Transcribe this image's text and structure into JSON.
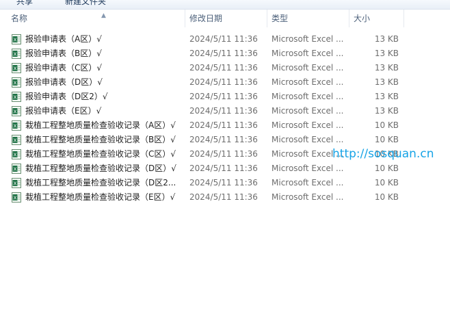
{
  "toolbar": {
    "share_label": "共享",
    "new_folder_label": "新建文件夹"
  },
  "columns": {
    "name": "名称",
    "date": "修改日期",
    "type": "类型",
    "size": "大小"
  },
  "files": [
    {
      "name": "报验申请表（A区）√",
      "date": "2024/5/11 11:36",
      "type": "Microsoft Excel ...",
      "size": "13 KB"
    },
    {
      "name": "报验申请表（B区）√",
      "date": "2024/5/11 11:36",
      "type": "Microsoft Excel ...",
      "size": "13 KB"
    },
    {
      "name": "报验申请表（C区）√",
      "date": "2024/5/11 11:36",
      "type": "Microsoft Excel ...",
      "size": "13 KB"
    },
    {
      "name": "报验申请表（D区）√",
      "date": "2024/5/11 11:36",
      "type": "Microsoft Excel ...",
      "size": "13 KB"
    },
    {
      "name": "报验申请表（D区2）√",
      "date": "2024/5/11 11:36",
      "type": "Microsoft Excel ...",
      "size": "13 KB"
    },
    {
      "name": "报验申请表（E区）√",
      "date": "2024/5/11 11:36",
      "type": "Microsoft Excel ...",
      "size": "13 KB"
    },
    {
      "name": "栽植工程整地质量检查验收记录（A区）√",
      "date": "2024/5/11 11:36",
      "type": "Microsoft Excel ...",
      "size": "10 KB"
    },
    {
      "name": "栽植工程整地质量检查验收记录（B区）√",
      "date": "2024/5/11 11:36",
      "type": "Microsoft Excel ...",
      "size": "10 KB"
    },
    {
      "name": "栽植工程整地质量检查验收记录（C区）√",
      "date": "2024/5/11 11:36",
      "type": "Microsoft Excel ...",
      "size": "10 KB"
    },
    {
      "name": "栽植工程整地质量检查验收记录（D区）√",
      "date": "2024/5/11 11:36",
      "type": "Microsoft Excel ...",
      "size": "10 KB"
    },
    {
      "name": "栽植工程整地质量检查验收记录（D区2...",
      "date": "2024/5/11 11:36",
      "type": "Microsoft Excel ...",
      "size": "10 KB"
    },
    {
      "name": "栽植工程整地质量检查验收记录（E区）√",
      "date": "2024/5/11 11:36",
      "type": "Microsoft Excel ...",
      "size": "10 KB"
    }
  ],
  "watermark": "http://sosquan.cn",
  "icon": "excel-file-icon",
  "colors": {
    "excel_green": "#1e7145",
    "watermark": "#16a3e6"
  }
}
